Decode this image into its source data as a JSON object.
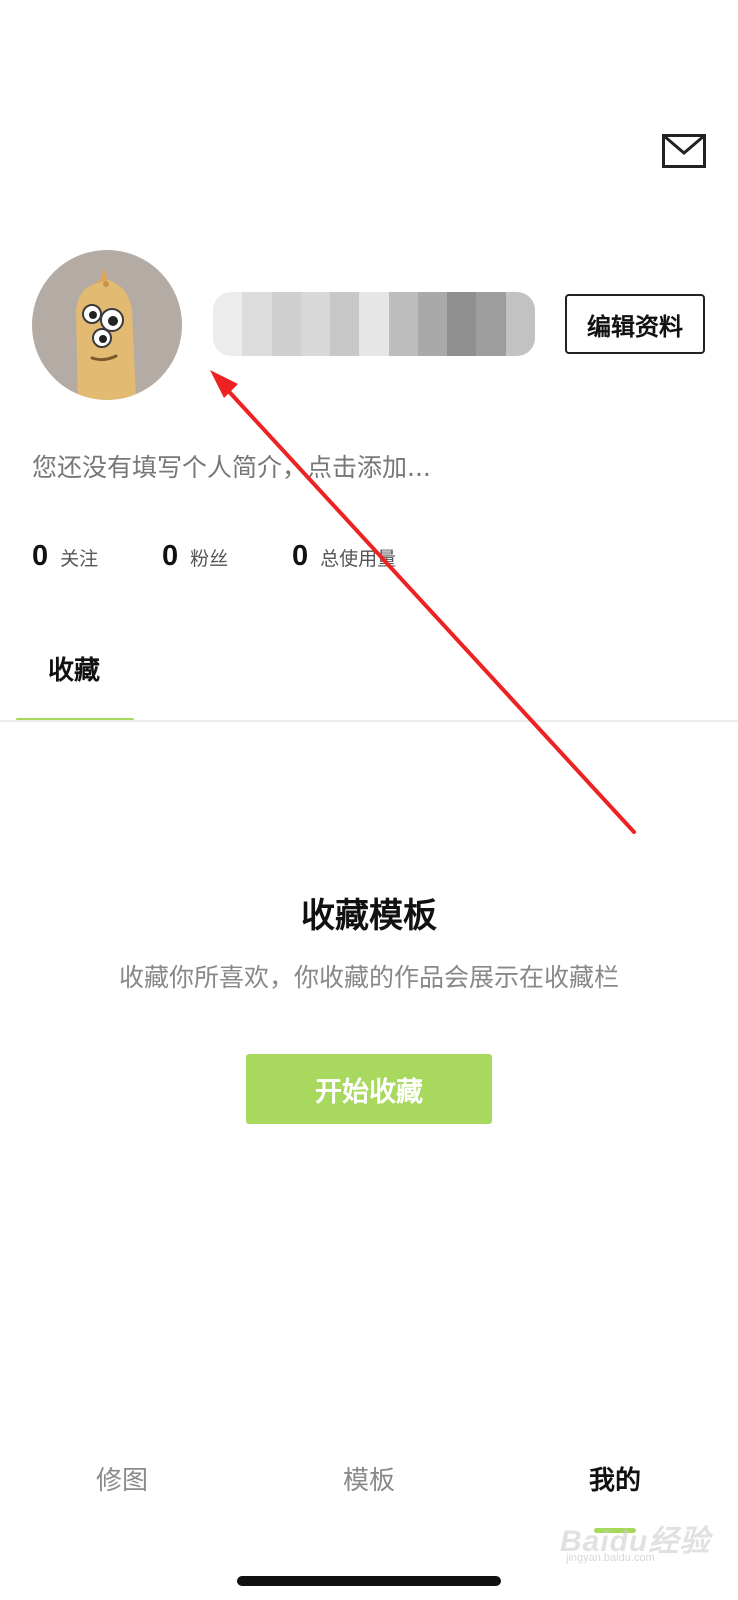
{
  "header": {
    "mail_icon": "mail-envelope-icon"
  },
  "profile": {
    "avatar_icon": "cartoon-avatar",
    "username": "",
    "edit_button_label": "编辑资料",
    "bio_placeholder": "您还没有填写个人简介，点击添加..."
  },
  "stats": [
    {
      "value": "0",
      "label": "关注"
    },
    {
      "value": "0",
      "label": "粉丝"
    },
    {
      "value": "0",
      "label": "总使用量"
    }
  ],
  "tabs": [
    {
      "label": "收藏",
      "active": true
    }
  ],
  "empty_state": {
    "title": "收藏模板",
    "description": "收藏你所喜欢，你收藏的作品会展示在收藏栏",
    "button_label": "开始收藏"
  },
  "bottom_nav": [
    {
      "label": "修图",
      "active": false
    },
    {
      "label": "模板",
      "active": false
    },
    {
      "label": "我的",
      "active": true
    }
  ],
  "colors": {
    "accent": "#a6d95a",
    "button": "#a8d95e",
    "annotation_arrow": "#ee2222"
  },
  "watermark": {
    "text": "Baidu经验",
    "sub": "jingyan.baidu.com"
  }
}
